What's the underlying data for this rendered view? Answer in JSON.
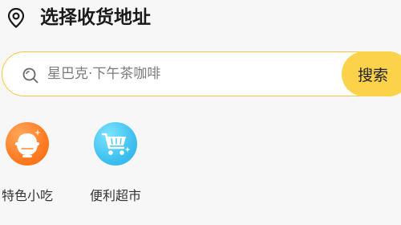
{
  "header": {
    "title": "选择收货地址",
    "icon": "location-pin-icon"
  },
  "search": {
    "placeholder": "星巴克·下午茶咖啡",
    "value": "",
    "button_label": "搜索",
    "icon": "search-icon"
  },
  "categories": [
    {
      "label": "特色小吃",
      "icon": "rice-bowl-icon",
      "color": "#ff7b22"
    },
    {
      "label": "便利超市",
      "icon": "shopping-cart-icon",
      "color": "#3fc1f0"
    }
  ],
  "colors": {
    "accent": "#fdd24b",
    "search_border": "#f5c542",
    "background": "#f7f7f7"
  }
}
